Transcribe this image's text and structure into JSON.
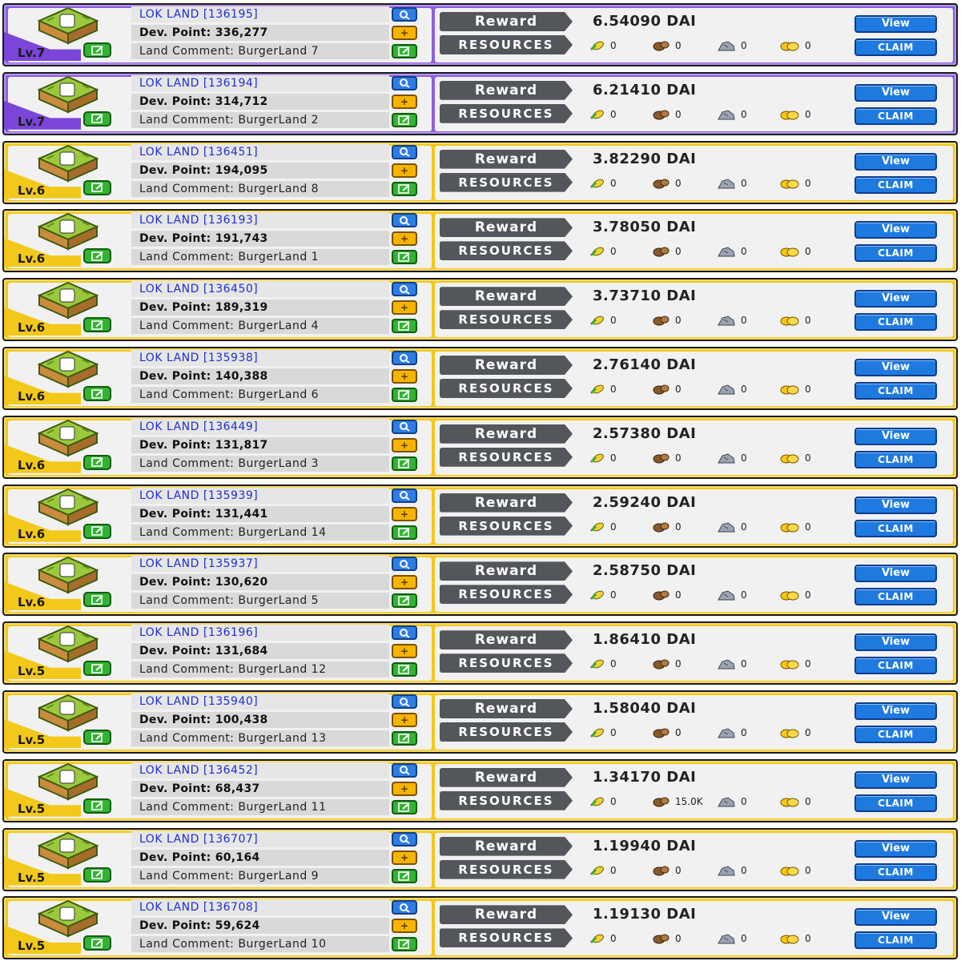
{
  "labels": {
    "reward": "Reward",
    "resources": "RESOURCES",
    "view": "View",
    "claim": "CLAIM",
    "plus": "+"
  },
  "colors": {
    "lv7_frame": "#8e5fe3",
    "lv6_lv5_frame": "#f2c81a",
    "button_blue": "#1f7ae0",
    "label_dark": "#53565b",
    "title_blue": "#1f2fd0"
  },
  "icons": [
    "land-tile-icon",
    "edit-icon",
    "search-icon",
    "plus-icon",
    "corn-icon",
    "wood-icon",
    "stone-icon",
    "gold-icon"
  ],
  "lands": [
    {
      "frame": "purple",
      "level": "Lv.7",
      "title": "LOK LAND [136195]",
      "dev_point": "Dev. Point: 336,277",
      "comment": "Land Comment: BurgerLand 7",
      "reward": "6.54090 DAI",
      "resources": [
        "0",
        "0",
        "0",
        "0"
      ]
    },
    {
      "frame": "purple",
      "level": "Lv.7",
      "title": "LOK LAND [136194]",
      "dev_point": "Dev. Point: 314,712",
      "comment": "Land Comment: BurgerLand 2",
      "reward": "6.21410 DAI",
      "resources": [
        "0",
        "0",
        "0",
        "0"
      ]
    },
    {
      "frame": "gold",
      "level": "Lv.6",
      "title": "LOK LAND [136451]",
      "dev_point": "Dev. Point: 194,095",
      "comment": "Land Comment: BurgerLand 8",
      "reward": "3.82290 DAI",
      "resources": [
        "0",
        "0",
        "0",
        "0"
      ]
    },
    {
      "frame": "gold",
      "level": "Lv.6",
      "title": "LOK LAND [136193]",
      "dev_point": "Dev. Point: 191,743",
      "comment": "Land Comment: BurgerLand 1",
      "reward": "3.78050 DAI",
      "resources": [
        "0",
        "0",
        "0",
        "0"
      ]
    },
    {
      "frame": "gold",
      "level": "Lv.6",
      "title": "LOK LAND [136450]",
      "dev_point": "Dev. Point: 189,319",
      "comment": "Land Comment: BurgerLand 4",
      "reward": "3.73710 DAI",
      "resources": [
        "0",
        "0",
        "0",
        "0"
      ]
    },
    {
      "frame": "gold",
      "level": "Lv.6",
      "title": "LOK LAND [135938]",
      "dev_point": "Dev. Point: 140,388",
      "comment": "Land Comment: BurgerLand 6",
      "reward": "2.76140 DAI",
      "resources": [
        "0",
        "0",
        "0",
        "0"
      ]
    },
    {
      "frame": "gold",
      "level": "Lv.6",
      "title": "LOK LAND [136449]",
      "dev_point": "Dev. Point: 131,817",
      "comment": "Land Comment: BurgerLand 3",
      "reward": "2.57380 DAI",
      "resources": [
        "0",
        "0",
        "0",
        "0"
      ]
    },
    {
      "frame": "gold",
      "level": "Lv.6",
      "title": "LOK LAND [135939]",
      "dev_point": "Dev. Point: 131,441",
      "comment": "Land Comment: BurgerLand 14",
      "reward": "2.59240 DAI",
      "resources": [
        "0",
        "0",
        "0",
        "0"
      ]
    },
    {
      "frame": "gold",
      "level": "Lv.6",
      "title": "LOK LAND [135937]",
      "dev_point": "Dev. Point: 130,620",
      "comment": "Land Comment: BurgerLand 5",
      "reward": "2.58750 DAI",
      "resources": [
        "0",
        "0",
        "0",
        "0"
      ]
    },
    {
      "frame": "gold",
      "level": "Lv.5",
      "title": "LOK LAND [136196]",
      "dev_point": "Dev. Point: 131,684",
      "comment": "Land Comment: BurgerLand 12",
      "reward": "1.86410 DAI",
      "resources": [
        "0",
        "0",
        "0",
        "0"
      ]
    },
    {
      "frame": "gold",
      "level": "Lv.5",
      "title": "LOK LAND [135940]",
      "dev_point": "Dev. Point: 100,438",
      "comment": "Land Comment: BurgerLand 13",
      "reward": "1.58040 DAI",
      "resources": [
        "0",
        "0",
        "0",
        "0"
      ]
    },
    {
      "frame": "gold",
      "level": "Lv.5",
      "title": "LOK LAND [136452]",
      "dev_point": "Dev. Point: 68,437",
      "comment": "Land Comment: BurgerLand 11",
      "reward": "1.34170 DAI",
      "resources": [
        "0",
        "15.0K",
        "0",
        "0"
      ]
    },
    {
      "frame": "gold",
      "level": "Lv.5",
      "title": "LOK LAND [136707]",
      "dev_point": "Dev. Point: 60,164",
      "comment": "Land Comment: BurgerLand 9",
      "reward": "1.19940 DAI",
      "resources": [
        "0",
        "0",
        "0",
        "0"
      ]
    },
    {
      "frame": "gold",
      "level": "Lv.5",
      "title": "LOK LAND [136708]",
      "dev_point": "Dev. Point: 59,624",
      "comment": "Land Comment: BurgerLand 10",
      "reward": "1.19130 DAI",
      "resources": [
        "0",
        "0",
        "0",
        "0"
      ]
    }
  ]
}
